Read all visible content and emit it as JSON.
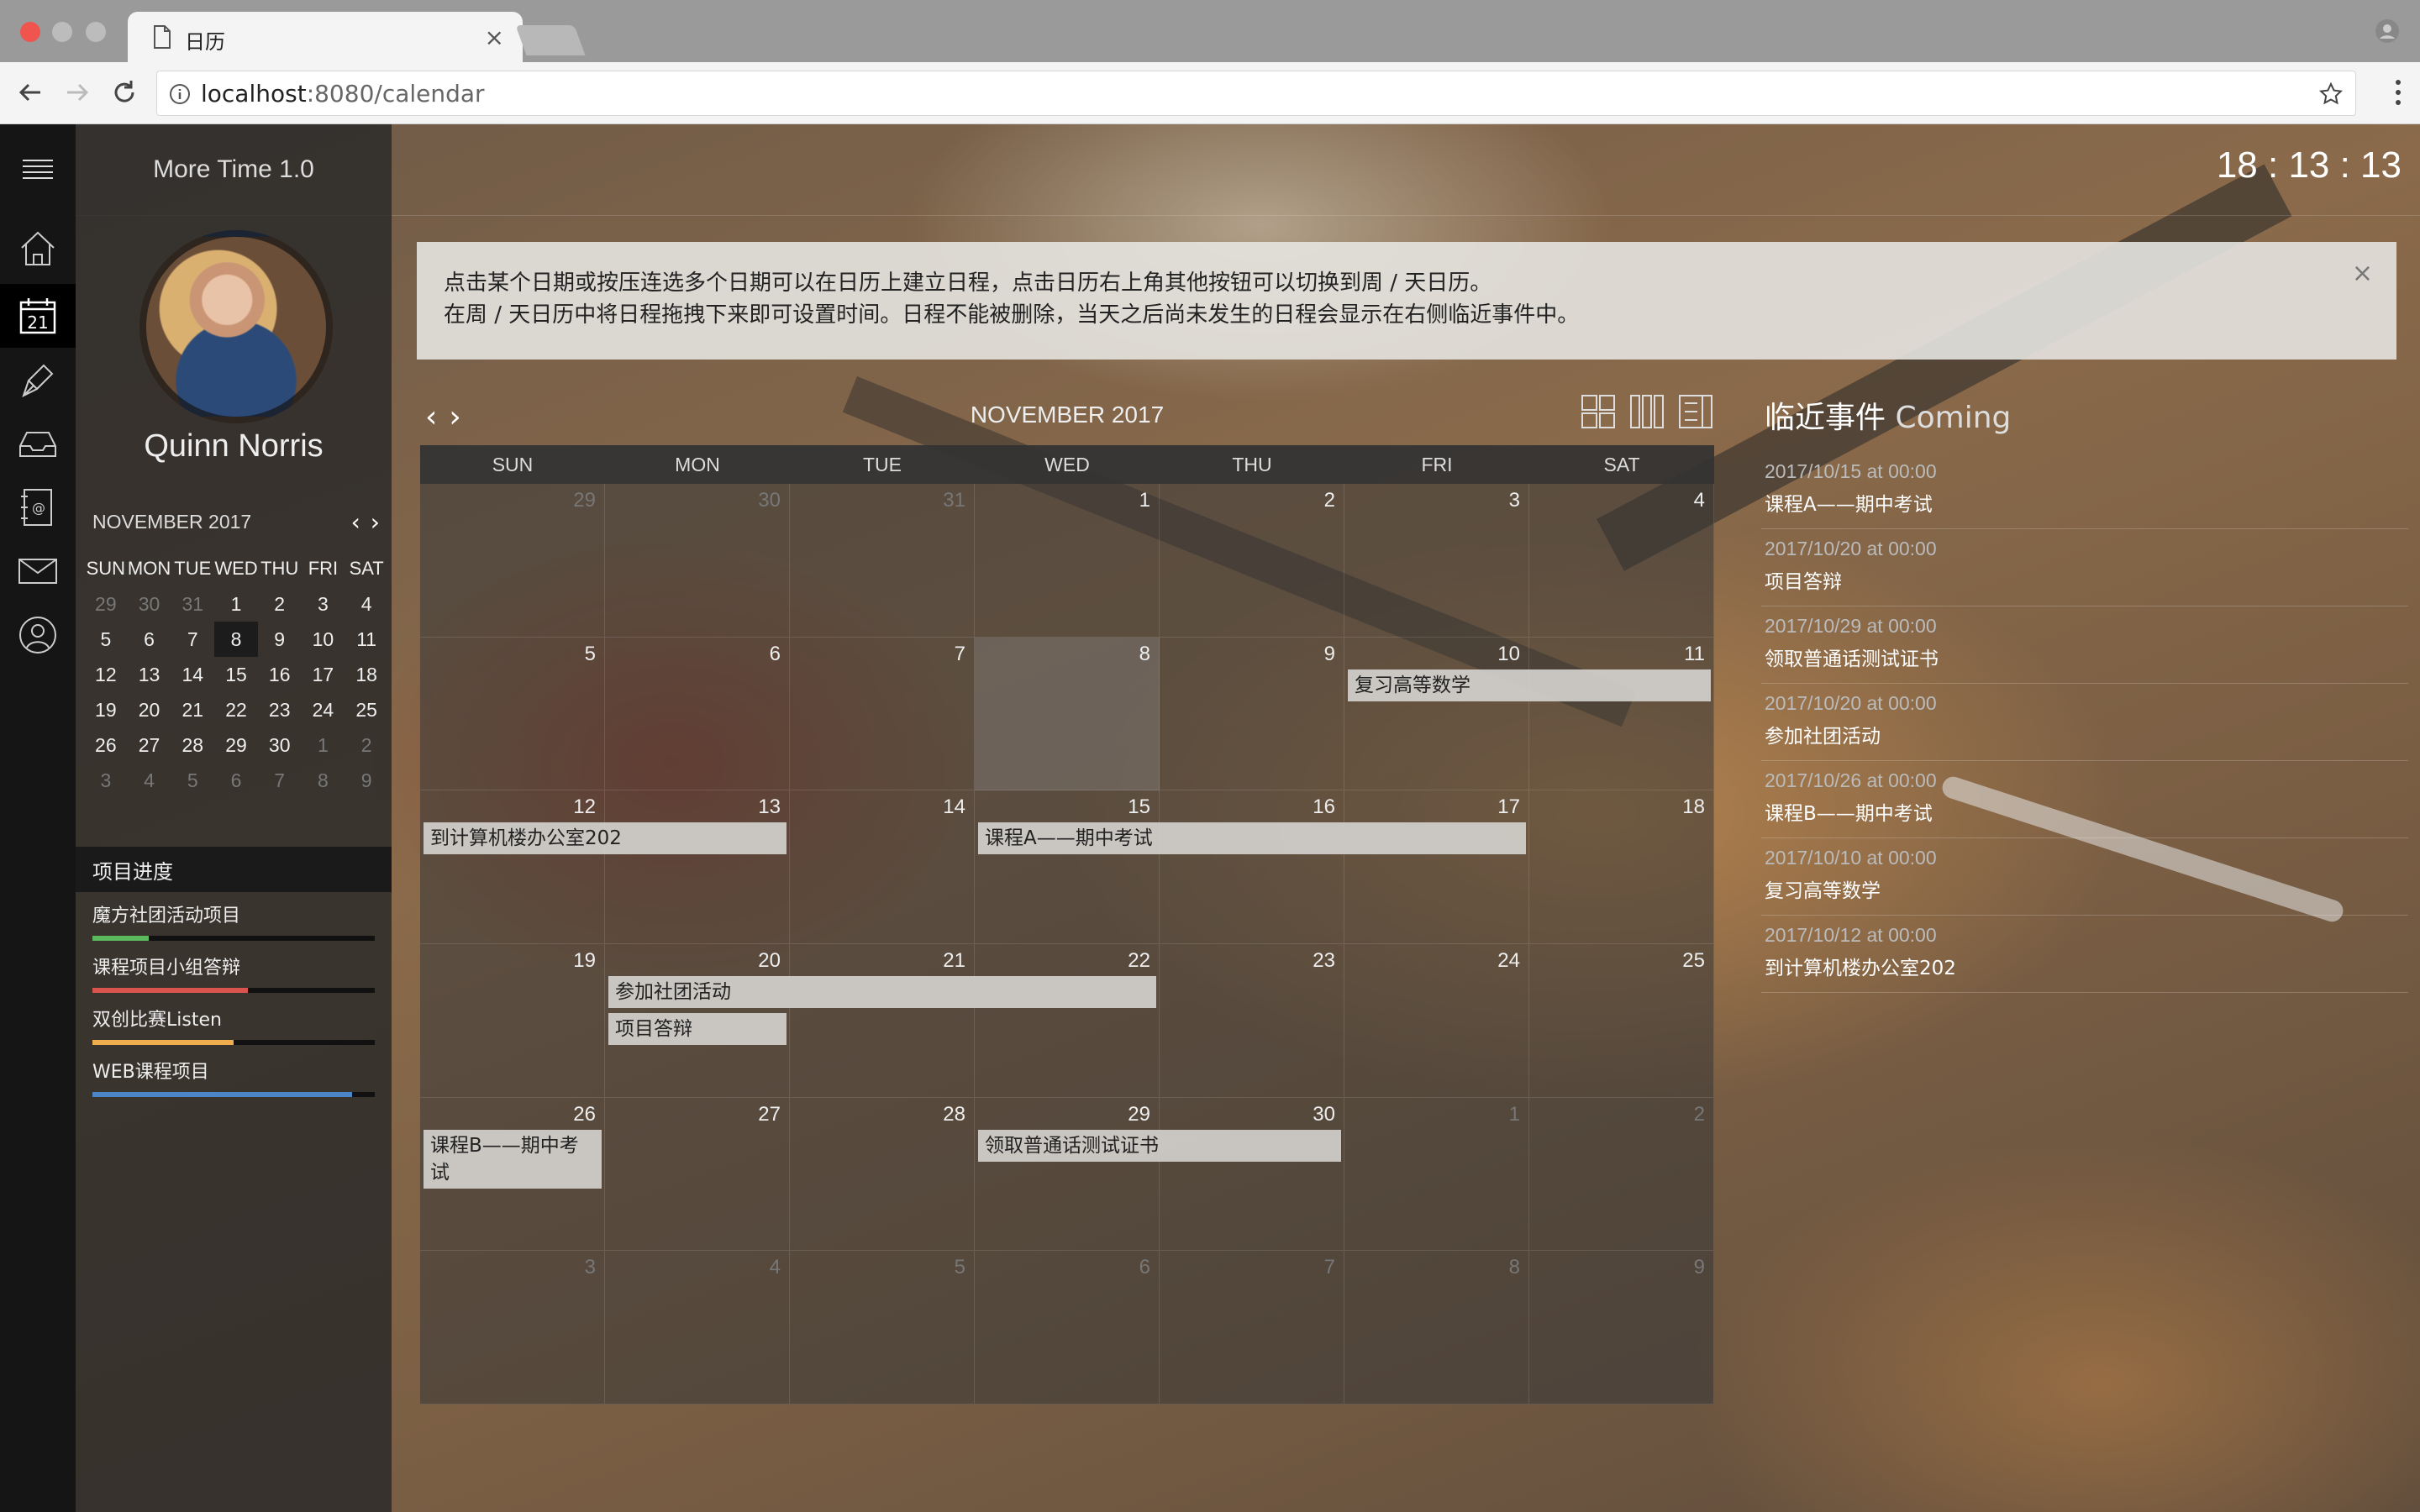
{
  "browser": {
    "tab_title": "日历",
    "url_host": "localhost",
    "url_rest": ":8080/calendar"
  },
  "app": {
    "title": "More Time 1.0",
    "clock": "18 : 13 : 13",
    "user_name": "Quinn Norris"
  },
  "nav_icons": [
    "home-icon",
    "calendar-icon",
    "pen-icon",
    "inbox-icon",
    "address-book-icon",
    "mail-icon",
    "user-icon"
  ],
  "mini_calendar": {
    "title": "NOVEMBER 2017",
    "dow": [
      "SUN",
      "MON",
      "TUE",
      "WED",
      "THU",
      "FRI",
      "SAT"
    ],
    "days": [
      "29",
      "30",
      "31",
      "1",
      "2",
      "3",
      "4",
      "5",
      "6",
      "7",
      "8",
      "9",
      "10",
      "11",
      "12",
      "13",
      "14",
      "15",
      "16",
      "17",
      "18",
      "19",
      "20",
      "21",
      "22",
      "23",
      "24",
      "25",
      "26",
      "27",
      "28",
      "29",
      "30",
      "1",
      "2",
      "3",
      "4",
      "5",
      "6",
      "7",
      "8",
      "9"
    ]
  },
  "progress": {
    "title": "项目进度",
    "items": [
      {
        "label": "魔方社团活动项目",
        "value": 0.2,
        "color": "#5cb85c"
      },
      {
        "label": "课程项目小组答辩",
        "value": 0.55,
        "color": "#d9534f"
      },
      {
        "label": "双创比赛Listen",
        "value": 0.5,
        "color": "#f0ad4e"
      },
      {
        "label": "WEB课程项目",
        "value": 0.92,
        "color": "#4a86c8"
      }
    ]
  },
  "alert": {
    "line1": "点击某个日期或按压连选多个日期可以在日历上建立日程，点击日历右上角其他按钮可以切换到周 / 天日历。",
    "line2": "在周 / 天日历中将日程拖拽下来即可设置时间。日程不能被删除，当天之后尚未发生的日程会显示在右侧临近事件中。",
    "close": "×"
  },
  "calendar": {
    "title": "NOVEMBER 2017",
    "dow": [
      "SUN",
      "MON",
      "TUE",
      "WED",
      "THU",
      "FRI",
      "SAT"
    ],
    "days": [
      "29",
      "30",
      "31",
      "1",
      "2",
      "3",
      "4",
      "5",
      "6",
      "7",
      "8",
      "9",
      "10",
      "11",
      "12",
      "13",
      "14",
      "15",
      "16",
      "17",
      "18",
      "19",
      "20",
      "21",
      "22",
      "23",
      "24",
      "25",
      "26",
      "27",
      "28",
      "29",
      "30",
      "1",
      "2",
      "3",
      "4",
      "5",
      "6",
      "7",
      "8",
      "9"
    ],
    "events": [
      {
        "title": "复习高等数学",
        "week": 1,
        "start": 5,
        "span": 2,
        "lane": 0
      },
      {
        "title": "到计算机楼办公室202",
        "week": 2,
        "start": 0,
        "span": 2,
        "lane": 0
      },
      {
        "title": "课程A——期中考试",
        "week": 2,
        "start": 3,
        "span": 3,
        "lane": 0
      },
      {
        "title": "参加社团活动",
        "week": 3,
        "start": 1,
        "span": 3,
        "lane": 0
      },
      {
        "title": "项目答辩",
        "week": 3,
        "start": 1,
        "span": 1,
        "lane": 1
      },
      {
        "title": "课程B——期中考试",
        "week": 4,
        "start": 0,
        "span": 1,
        "lane": 0
      },
      {
        "title": "领取普通话测试证书",
        "week": 4,
        "start": 3,
        "span": 2,
        "lane": 0
      }
    ]
  },
  "coming": {
    "title": "临近事件",
    "subtitle": "Coming",
    "items": [
      {
        "time": "2017/10/15 at 00:00",
        "title": "课程A——期中考试"
      },
      {
        "time": "2017/10/20 at 00:00",
        "title": "项目答辩"
      },
      {
        "time": "2017/10/29 at 00:00",
        "title": "领取普通话测试证书"
      },
      {
        "time": "2017/10/20 at 00:00",
        "title": "参加社团活动"
      },
      {
        "time": "2017/10/26 at 00:00",
        "title": "课程B——期中考试"
      },
      {
        "time": "2017/10/10 at 00:00",
        "title": "复习高等数学"
      },
      {
        "time": "2017/10/12 at 00:00",
        "title": "到计算机楼办公室202"
      }
    ]
  }
}
